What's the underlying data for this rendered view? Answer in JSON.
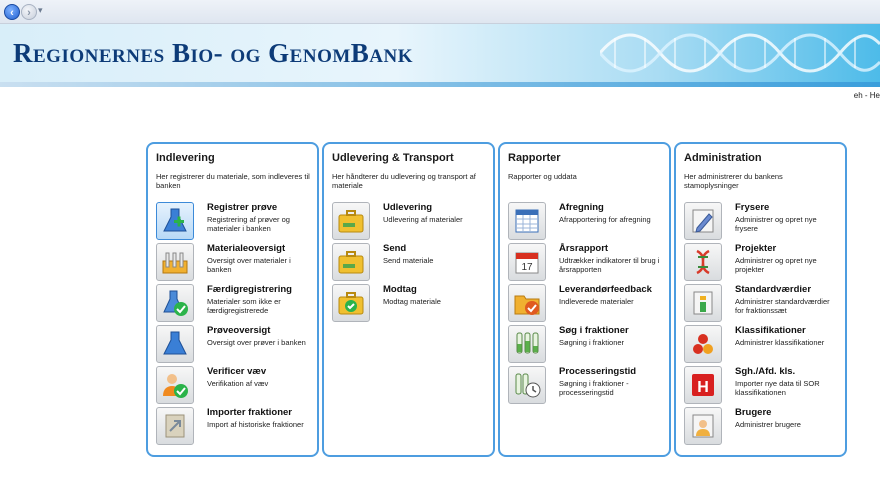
{
  "banner": {
    "title": "Regionernes Bio- og GenomBank"
  },
  "user": {
    "text": "eh - He"
  },
  "panels": [
    {
      "title": "Indlevering",
      "description": "Her registrerer du materiale, som indleveres til banken",
      "items": [
        {
          "title": "Registrer prøve",
          "description": "Registrering af prøver og materialer i banken",
          "icon": "flask-plus-icon",
          "active": true
        },
        {
          "title": "Materialeoversigt",
          "description": "Oversigt over materialer i banken",
          "icon": "test-tube-rack-icon"
        },
        {
          "title": "Færdigregistrering",
          "description": "Materialer som ikke er færdigregistrerede",
          "icon": "flask-check-icon"
        },
        {
          "title": "Prøveoversigt",
          "description": "Oversigt over prøver i banken",
          "icon": "flask-icon"
        },
        {
          "title": "Verificer væv",
          "description": "Verifikation af væv",
          "icon": "user-check-icon"
        },
        {
          "title": "Importer fraktioner",
          "description": "Import af historiske fraktioner",
          "icon": "import-icon"
        }
      ]
    },
    {
      "title": "Udlevering & Transport",
      "description": "Her håndterer du udlevering og transport af materiale",
      "items": [
        {
          "title": "Udlevering",
          "description": "Udlevering af materialer",
          "icon": "briefcase-icon"
        },
        {
          "title": "Send",
          "description": "Send materiale",
          "icon": "briefcase-icon"
        },
        {
          "title": "Modtag",
          "description": "Modtag materiale",
          "icon": "briefcase-check-icon"
        }
      ]
    },
    {
      "title": "Rapporter",
      "description": "Rapporter og uddata",
      "items": [
        {
          "title": "Afregning",
          "description": "Afrapportering for afregning",
          "icon": "spreadsheet-icon"
        },
        {
          "title": "Årsrapport",
          "description": "Udtrækker indikatorer til brug i årsrapporten",
          "icon": "calendar-icon"
        },
        {
          "title": "Leverandørfeedback",
          "description": "Indleverede materialer",
          "icon": "folder-check-icon"
        },
        {
          "title": "Søg i fraktioner",
          "description": "Søgning i fraktioner",
          "icon": "test-tubes-icon"
        },
        {
          "title": "Processeringstid",
          "description": "Søgning i fraktioner - processeringstid",
          "icon": "test-tubes-clock-icon"
        }
      ]
    },
    {
      "title": "Administration",
      "description": "Her administrerer du bankens stamoplysninger",
      "items": [
        {
          "title": "Frysere",
          "description": "Administrer og opret nye frysere",
          "icon": "pencil-icon"
        },
        {
          "title": "Projekter",
          "description": "Administrer og opret nye projekter",
          "icon": "dna-icon"
        },
        {
          "title": "Standardværdier",
          "description": "Administrer standardværdier for fraktionssæt",
          "icon": "info-icon"
        },
        {
          "title": "Klassifikationer",
          "description": "Administrer klassifikationer",
          "icon": "molecule-icon"
        },
        {
          "title": "Sgh./Afd. kls.",
          "description": "Importer nye data til SOR klassifikationen",
          "icon": "hospital-icon"
        },
        {
          "title": "Brugere",
          "description": "Administrer brugere",
          "icon": "user-icon"
        }
      ]
    }
  ],
  "colors": {
    "panel_border": "#4d9de0",
    "title_blue": "#0d3b78"
  }
}
